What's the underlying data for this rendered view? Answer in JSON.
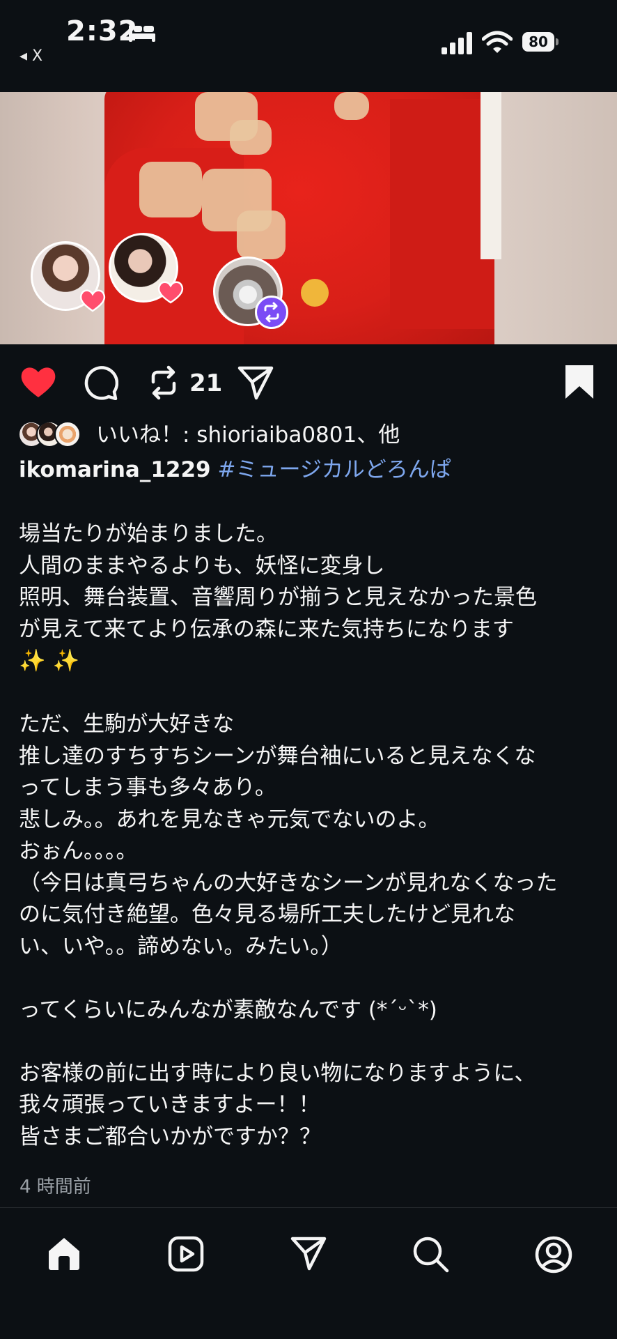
{
  "status_bar": {
    "time": "2:32",
    "back_label": "◂ X",
    "battery": "80"
  },
  "post": {
    "actions": {
      "repost_count": "21"
    },
    "likes": {
      "text": "いいね！: shioriaiba0801、他"
    },
    "author": "ikomarina_1229",
    "hashtag": "#ミュージカルどろんぱ",
    "caption_lines": [
      "場当たりが始まりました。",
      "人間のままやるよりも、妖怪に変身し",
      "照明、舞台装置、音響周りが揃うと見えなかった景色",
      "が見えて来てより伝承の森に来た気持ちになります",
      "✨ ✨",
      "",
      "ただ、生駒が大好きな",
      "推し達のすちすちシーンが舞台袖にいると見えなくな",
      "ってしまう事も多々あり。",
      "悲しみ。。あれを見なきゃ元気でないのよ。",
      "おぉん。。。。",
      "（今日は真弓ちゃんの大好きなシーンが見れなくなった",
      "のに気付き絶望。色々見る場所工夫したけど見れな",
      "い、いや。。諦めない。みたい。）",
      "",
      "ってくらいにみんなが素敵なんです (*´ᵕ`*)",
      "",
      "お客様の前に出す時により良い物になりますように、",
      "我々頑張っていきますよー！！",
      "皆さまご都合いかがですか？？"
    ],
    "timestamp": "4 時間前"
  },
  "icons": {
    "status": [
      "bed-icon",
      "signal-icon",
      "wifi-icon",
      "battery-icon"
    ],
    "actions": [
      "heart-icon",
      "comment-icon",
      "repost-icon",
      "share-icon",
      "bookmark-icon"
    ],
    "bottom_nav": [
      "home-icon",
      "reels-icon",
      "send-icon",
      "search-icon",
      "profile-icon"
    ]
  },
  "colors": {
    "background": "#0c1014",
    "heart": "#ff3040",
    "hashtag": "#7ea7ee",
    "repost_badge": "#7b4cf5",
    "muted_text": "#9aa0a6"
  }
}
